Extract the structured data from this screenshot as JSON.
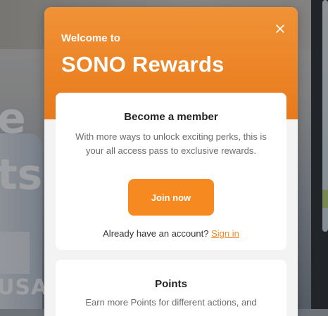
{
  "background": {
    "hero_line_1": "e",
    "hero_line_2": "ts",
    "hero_line_3": "USA"
  },
  "modal": {
    "welcome": "Welcome to",
    "brand": "SONO Rewards",
    "close_icon": "close-icon",
    "member": {
      "title": "Become a member",
      "description": "With more ways to unlock exciting perks, this is your all access pass to exclusive rewards.",
      "join_label": "Join now",
      "signin_prompt": "Already have an account?",
      "signin_label": "Sign in"
    },
    "points": {
      "title": "Points",
      "description": "Earn more Points for different actions, and"
    }
  },
  "colors": {
    "accent": "#f6891f",
    "header_top": "#f09236",
    "header_bottom": "#e87a1b",
    "link": "#f08a24"
  }
}
